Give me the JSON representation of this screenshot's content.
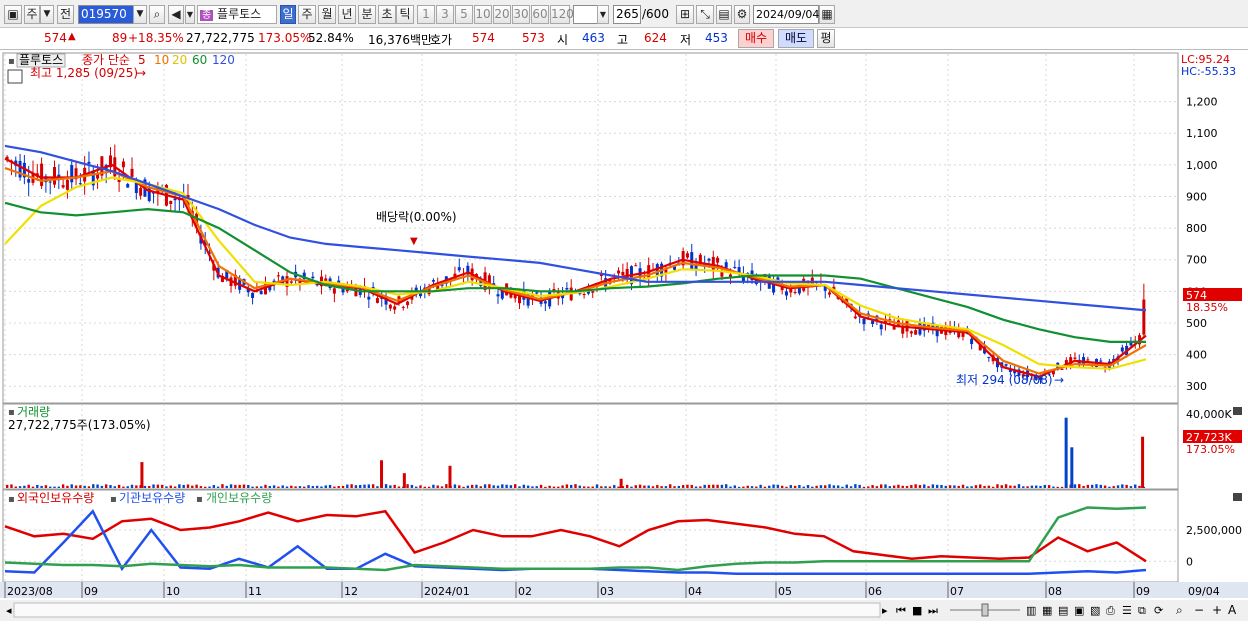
{
  "toolbar": {
    "type_label": "주",
    "prev_label": "전",
    "code": "019570",
    "name": "플루토스",
    "period_day": "일",
    "period_week": "주",
    "period_month": "월",
    "period_year": "년",
    "period_min": "분",
    "period_sec": "초",
    "period_tick": "틱",
    "intervals": [
      "1",
      "3",
      "5",
      "10",
      "20",
      "30",
      "60",
      "120"
    ],
    "count": "265",
    "total": "/600",
    "date": "2024/09/04"
  },
  "quote": {
    "price": "574",
    "change": "89",
    "rate": "+18.35%",
    "volume": "27,722,775",
    "vol_rate": "173.05%",
    "turnover": "52.84%",
    "amount": "16,376백만",
    "hoga_label": "호가",
    "ask": "574",
    "bid": "573",
    "open_label": "시",
    "open": "463",
    "high_label": "고",
    "high": "624",
    "low_label": "저",
    "low": "453",
    "buy_label": "매수",
    "sell_label": "매도",
    "eval_label": "평"
  },
  "colors": {
    "up": "#d40000",
    "down": "#0033cc",
    "ma5": "#e00000",
    "ma10": "#f07000",
    "ma20": "#f0e000",
    "ma60": "#109030",
    "ma120": "#3050e0",
    "vol_up": "#d40000",
    "vol_down": "#0044cc",
    "foreign": "#e00000",
    "institution": "#2050f0",
    "individual": "#30a050"
  },
  "labels": {
    "price_legend_name": "플루토스",
    "ma_prefix": "종가 단순",
    "ma_periods": [
      "5",
      "10",
      "20",
      "60",
      "120"
    ],
    "high_note": "최고 1,285 (09/25)",
    "low_note": "최저 294 (08/08)",
    "dividend_note": "배당락(0.00%)",
    "lc": "LC:95.24",
    "hc": "HC:-55.33",
    "current_price": "574",
    "current_rate": "18.35%",
    "volume_title": "거래량",
    "volume_value": "27,722,775주(173.05%)",
    "volume_current": "27,723K",
    "volume_rate": "173.05%",
    "foreign_label": "외국인보유수량",
    "inst_label": "기관보유수량",
    "indiv_label": "개인보유수량"
  },
  "chart_data": [
    {
      "type": "candlestick",
      "title": "플루토스",
      "ylim": [
        250,
        1300
      ],
      "y_ticks": [
        300,
        400,
        500,
        600,
        700,
        800,
        900,
        1000,
        1100,
        1200
      ],
      "y_tick_labels": [
        "300",
        "400",
        "500",
        "600",
        "700",
        "800",
        "900",
        "1,000",
        "1,100",
        "1,200"
      ],
      "x_labels": [
        "2023/08",
        "09",
        "10",
        "11",
        "12",
        "2024/01",
        "02",
        "03",
        "04",
        "05",
        "06",
        "07",
        "08",
        "09",
        "09/04"
      ],
      "last": {
        "open": 463,
        "high": 624,
        "low": 453,
        "close": 574
      },
      "ma": [
        {
          "name": "5",
          "values": [
            1020,
            960,
            960,
            1000,
            920,
            890,
            650,
            600,
            640,
            620,
            610,
            560,
            620,
            660,
            600,
            570,
            600,
            640,
            660,
            700,
            680,
            640,
            610,
            620,
            520,
            490,
            480,
            470,
            360,
            330,
            380,
            370,
            460
          ]
        },
        {
          "name": "10",
          "values": [
            990,
            950,
            960,
            980,
            930,
            900,
            680,
            610,
            640,
            625,
            612,
            570,
            615,
            650,
            605,
            575,
            598,
            630,
            650,
            690,
            675,
            645,
            615,
            620,
            530,
            500,
            485,
            475,
            380,
            340,
            370,
            365,
            430
          ]
        },
        {
          "name": "20",
          "values": [
            750,
            870,
            930,
            960,
            940,
            910,
            760,
            630,
            620,
            630,
            615,
            590,
            600,
            630,
            610,
            585,
            595,
            615,
            640,
            670,
            665,
            650,
            625,
            620,
            555,
            515,
            495,
            480,
            430,
            370,
            360,
            355,
            385
          ]
        },
        {
          "name": "60",
          "values": [
            880,
            850,
            840,
            850,
            860,
            850,
            800,
            730,
            660,
            620,
            600,
            600,
            600,
            610,
            610,
            600,
            600,
            610,
            615,
            625,
            640,
            650,
            650,
            650,
            640,
            610,
            580,
            550,
            510,
            480,
            455,
            440,
            440
          ]
        },
        {
          "name": "120",
          "values": [
            1060,
            1040,
            1010,
            980,
            940,
            900,
            860,
            810,
            770,
            750,
            740,
            730,
            720,
            710,
            700,
            690,
            670,
            650,
            630,
            630,
            630,
            630,
            630,
            630,
            620,
            610,
            600,
            590,
            580,
            570,
            560,
            550,
            540
          ]
        }
      ]
    },
    {
      "type": "bar",
      "title": "거래량",
      "ylim": [
        0,
        40000
      ],
      "y_ticks": [
        40000
      ],
      "y_tick_labels": [
        "40,000K"
      ],
      "current": "27,723K",
      "spikes": [
        {
          "pos": 0.12,
          "value": 14000,
          "up": true
        },
        {
          "pos": 0.33,
          "value": 15000,
          "up": true
        },
        {
          "pos": 0.35,
          "value": 8000,
          "up": true
        },
        {
          "pos": 0.39,
          "value": 12000,
          "up": true
        },
        {
          "pos": 0.54,
          "value": 5000,
          "up": true
        },
        {
          "pos": 0.93,
          "value": 38000,
          "up": false
        },
        {
          "pos": 0.935,
          "value": 22000,
          "up": false
        },
        {
          "pos": 0.997,
          "value": 27723,
          "up": true
        }
      ]
    },
    {
      "type": "line",
      "title": "보유수량",
      "ylim": [
        -1500000,
        4500000
      ],
      "y_ticks": [
        0,
        2500000
      ],
      "y_tick_labels": [
        "0",
        "2,500,000"
      ],
      "series": [
        {
          "name": "외국인보유수량",
          "values": [
            2800000,
            2000000,
            2200000,
            1800000,
            3200000,
            3400000,
            2500000,
            2700000,
            3200000,
            3900000,
            3200000,
            3700000,
            3600000,
            4000000,
            700000,
            1500000,
            2500000,
            2000000,
            2000000,
            2500000,
            2000000,
            1200000,
            2500000,
            3200000,
            3300000,
            3000000,
            2700000,
            2200000,
            2000000,
            800000,
            500000,
            200000,
            400000,
            300000,
            200000,
            300000,
            1900000,
            800000,
            1500000,
            0
          ]
        },
        {
          "name": "기관보유수량",
          "values": [
            -800000,
            -900000,
            1500000,
            4000000,
            -600000,
            2500000,
            -500000,
            -600000,
            200000,
            -500000,
            1200000,
            -600000,
            -600000,
            600000,
            -400000,
            -500000,
            -600000,
            -700000,
            -600000,
            -600000,
            -600000,
            -700000,
            -800000,
            -900000,
            -900000,
            -1000000,
            -1000000,
            -1000000,
            -1000000,
            -1000000,
            -1000000,
            -1000000,
            -1000000,
            -1000000,
            -1000000,
            -1000000,
            -900000,
            -800000,
            -900000,
            -700000
          ]
        },
        {
          "name": "개인보유수량",
          "values": [
            -100000,
            -200000,
            -300000,
            -300000,
            -400000,
            -200000,
            -300000,
            -400000,
            -300000,
            -500000,
            -500000,
            -500000,
            -600000,
            -700000,
            -300000,
            -400000,
            -500000,
            -600000,
            -600000,
            -600000,
            -600000,
            -500000,
            -500000,
            -700000,
            -400000,
            -200000,
            -100000,
            -100000,
            0,
            0,
            0,
            0,
            0,
            0,
            0,
            0,
            3500000,
            4300000,
            4200000,
            4300000
          ]
        }
      ]
    }
  ]
}
